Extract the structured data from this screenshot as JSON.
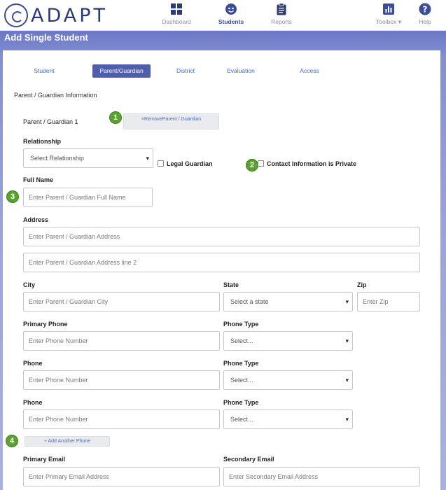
{
  "app": {
    "logo_text": "ADAPT"
  },
  "nav": {
    "dashboard": "Dashboard",
    "students": "Students",
    "reports": "Reports",
    "toolbox": "Toolbox ▾",
    "help": "Help"
  },
  "page_title": "Add Single Student",
  "tabs": [
    {
      "label": "Student"
    },
    {
      "label": "Parent/Guardian"
    },
    {
      "label": "District"
    },
    {
      "label": "Evaluation"
    },
    {
      "label": "Access"
    }
  ],
  "section_title": "Parent / Guardian Information",
  "guardian": {
    "heading": "Parent / Guardian 1",
    "remove_button": "×RemoveParent / Guardian",
    "relationship_label": "Relationship",
    "relationship_value": "Select Relationship",
    "legal_guardian_label": "Legal Guardian",
    "private_label": "Contact Information is Private",
    "fullname_label": "Full Name",
    "fullname_placeholder": "Enter Parent / Guardian Full Name",
    "address_label": "Address",
    "address1_placeholder": "Enter Parent / Guardian Address",
    "address2_placeholder": "Enter Parent / Guardian Address line 2",
    "city_label": "City",
    "city_placeholder": "Enter Parent / Guardian City",
    "state_label": "State",
    "state_value": "Select a state",
    "zip_label": "Zip",
    "zip_placeholder": "Enter Zip",
    "primary_phone_label": "Primary Phone",
    "phone_label": "Phone",
    "phone_placeholder": "Enter Phone Number",
    "phone_type_label": "Phone Type",
    "phone_type_value": "Select...",
    "add_phone_button": "+ Add Another Phone",
    "primary_email_label": "Primary Email",
    "primary_email_placeholder": "Enter Primary Email Address",
    "secondary_email_label": "Secondary Email",
    "secondary_email_placeholder": "Enter Secondary Email Address"
  },
  "badges": [
    "1",
    "2",
    "3",
    "4"
  ],
  "colors": {
    "accent": "#4e5eab",
    "badge": "#5aa32e",
    "link": "#3a6bd4"
  }
}
